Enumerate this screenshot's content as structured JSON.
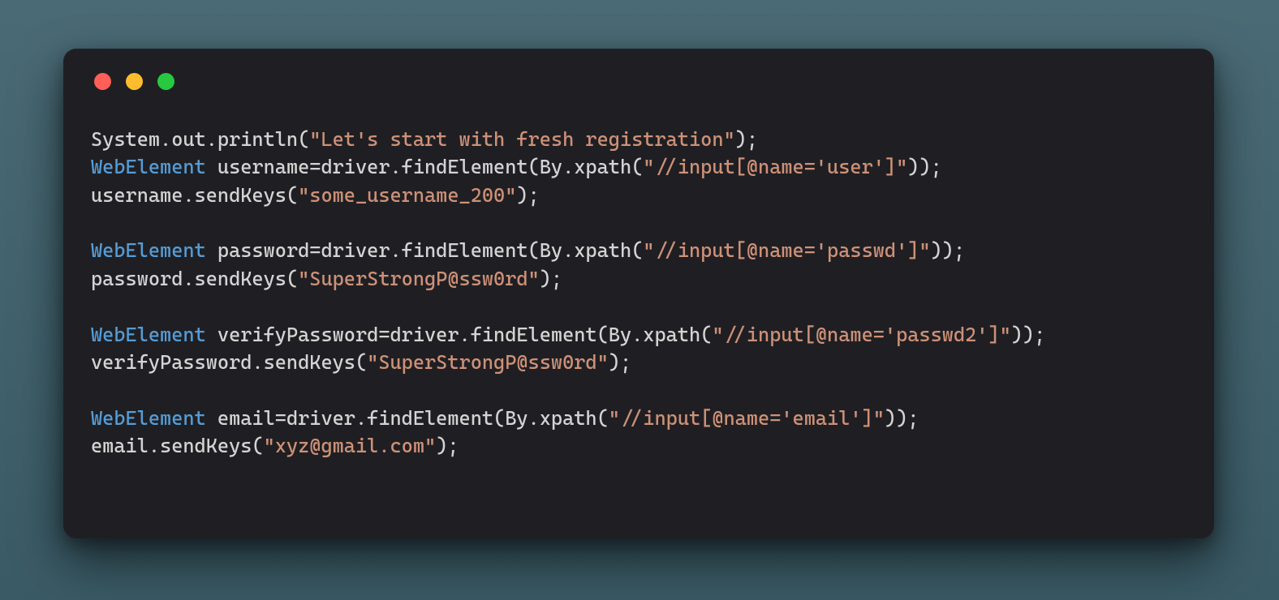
{
  "window": {
    "traffic_lights": [
      "close",
      "minimize",
      "zoom"
    ]
  },
  "code": {
    "lines": [
      [
        {
          "cls": "tok-default",
          "text": "System.out.println("
        },
        {
          "cls": "tok-string",
          "text": "\"Let's start with fresh registration\""
        },
        {
          "cls": "tok-default",
          "text": ");"
        }
      ],
      [
        {
          "cls": "tok-type",
          "text": "WebElement"
        },
        {
          "cls": "tok-default",
          "text": " username=driver.findElement(By.xpath("
        },
        {
          "cls": "tok-string",
          "text": "\"//input[@name='user']\""
        },
        {
          "cls": "tok-default",
          "text": "));"
        }
      ],
      [
        {
          "cls": "tok-default",
          "text": "username.sendKeys("
        },
        {
          "cls": "tok-string",
          "text": "\"some_username_200\""
        },
        {
          "cls": "tok-default",
          "text": ");"
        }
      ],
      [],
      [
        {
          "cls": "tok-type",
          "text": "WebElement"
        },
        {
          "cls": "tok-default",
          "text": " password=driver.findElement(By.xpath("
        },
        {
          "cls": "tok-string",
          "text": "\"//input[@name='passwd']\""
        },
        {
          "cls": "tok-default",
          "text": "));"
        }
      ],
      [
        {
          "cls": "tok-default",
          "text": "password.sendKeys("
        },
        {
          "cls": "tok-string",
          "text": "\"SuperStrongP@ssw0rd\""
        },
        {
          "cls": "tok-default",
          "text": ");"
        }
      ],
      [],
      [
        {
          "cls": "tok-type",
          "text": "WebElement"
        },
        {
          "cls": "tok-default",
          "text": " verifyPassword=driver.findElement(By.xpath("
        },
        {
          "cls": "tok-string",
          "text": "\"//input[@name='passwd2']\""
        },
        {
          "cls": "tok-default",
          "text": "));"
        }
      ],
      [
        {
          "cls": "tok-default",
          "text": "verifyPassword.sendKeys("
        },
        {
          "cls": "tok-string",
          "text": "\"SuperStrongP@ssw0rd\""
        },
        {
          "cls": "tok-default",
          "text": ");"
        }
      ],
      [],
      [
        {
          "cls": "tok-type",
          "text": "WebElement"
        },
        {
          "cls": "tok-default",
          "text": " email=driver.findElement(By.xpath("
        },
        {
          "cls": "tok-string",
          "text": "\"//input[@name='email']\""
        },
        {
          "cls": "tok-default",
          "text": "));"
        }
      ],
      [
        {
          "cls": "tok-default",
          "text": "email.sendKeys("
        },
        {
          "cls": "tok-string",
          "text": "\"xyz@gmail.com\""
        },
        {
          "cls": "tok-default",
          "text": ");"
        }
      ]
    ]
  }
}
